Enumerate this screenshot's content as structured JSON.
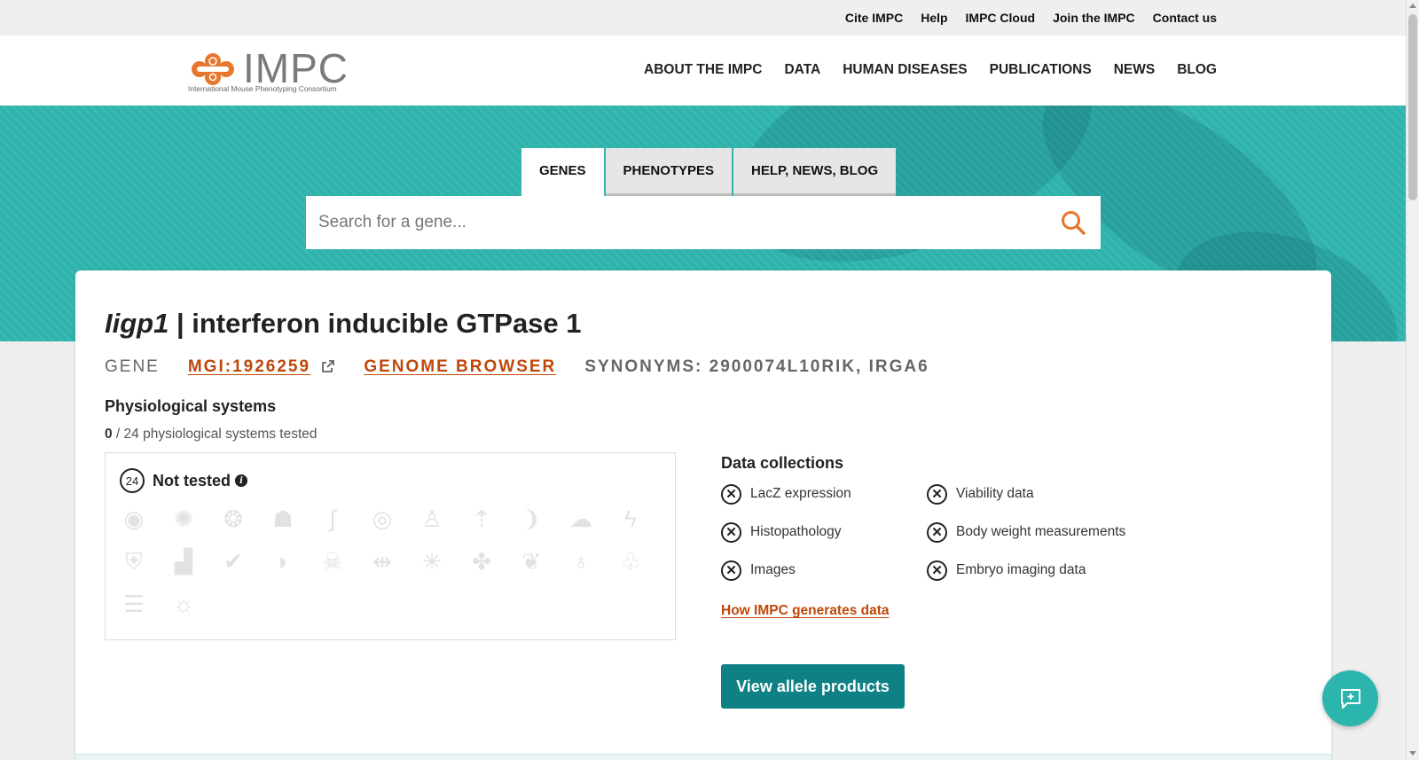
{
  "topbar": {
    "links": [
      "Cite IMPC",
      "Help",
      "IMPC Cloud",
      "Join the IMPC",
      "Contact us"
    ]
  },
  "header": {
    "logo_text": "IMPC",
    "logo_tagline": "International Mouse Phenotyping Consortium",
    "nav": [
      "ABOUT THE IMPC",
      "DATA",
      "HUMAN DISEASES",
      "PUBLICATIONS",
      "NEWS",
      "BLOG"
    ]
  },
  "search": {
    "tabs": [
      {
        "label": "GENES",
        "active": true
      },
      {
        "label": "PHENOTYPES",
        "active": false
      },
      {
        "label": "HELP, NEWS, BLOG",
        "active": false
      }
    ],
    "placeholder": "Search for a gene...",
    "icon": "search-icon"
  },
  "gene": {
    "symbol": "Iigp1",
    "separator": " | ",
    "name": "interferon inducible GTPase 1",
    "type_label": "GENE",
    "mgi_id": "MGI:1926259",
    "genome_browser": "GENOME BROWSER",
    "synonyms": "SYNONYMS: 2900074L10RIK, IRGA6"
  },
  "physiological": {
    "title": "Physiological systems",
    "tested_count": "0",
    "tested_suffix": " / 24 physiological systems tested",
    "not_tested_count": "24",
    "not_tested_label": "Not tested",
    "system_icons": [
      "adipose-icon",
      "immune-icon",
      "embryo-icon",
      "skull-icon",
      "digestive-icon",
      "eye-ball-icon",
      "hand-icon",
      "growth-icon",
      "hearing-icon",
      "homeostasis-icon",
      "nervous-icon",
      "immune-shield-icon",
      "integument-icon",
      "limbs-icon",
      "liver-icon",
      "mortality-icon",
      "muscle-icon",
      "neoplasm-icon",
      "pigmentation-icon",
      "renal-icon",
      "reproductive-icon",
      "respiratory-icon",
      "skeleton-icon",
      "vision-icon"
    ]
  },
  "data_collections": {
    "title": "Data collections",
    "items": [
      {
        "label": "LacZ expression",
        "available": false
      },
      {
        "label": "Viability data",
        "available": false
      },
      {
        "label": "Histopathology",
        "available": false
      },
      {
        "label": "Body weight measurements",
        "available": false
      },
      {
        "label": "Images",
        "available": false
      },
      {
        "label": "Embryo imaging data",
        "available": false
      }
    ],
    "how_link": "How IMPC generates data",
    "allele_button": "View allele products"
  },
  "colors": {
    "teal": "#2fb3ad",
    "dark_teal": "#0f8185",
    "orange_link": "#c0470a",
    "logo_orange": "#e8772e"
  }
}
